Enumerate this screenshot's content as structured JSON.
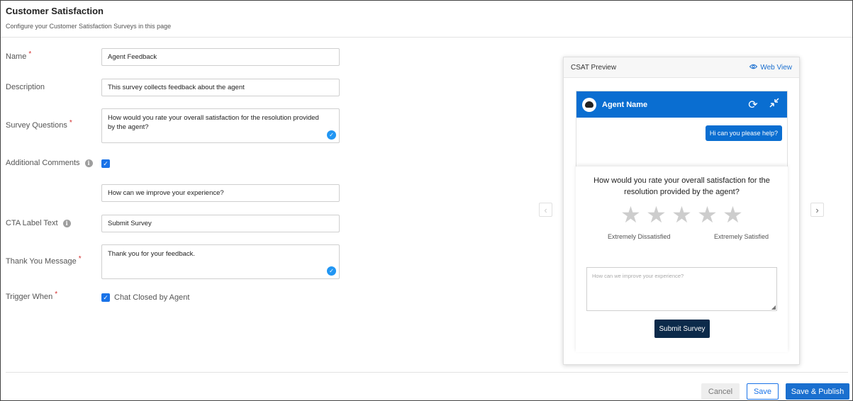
{
  "page": {
    "title": "Customer Satisfaction",
    "subtitle": "Configure your Customer Satisfaction Surveys in this page"
  },
  "form": {
    "name": {
      "label": "Name",
      "value": "Agent Feedback"
    },
    "description": {
      "label": "Description",
      "value": "This survey collects feedback about the agent"
    },
    "survey_questions": {
      "label": "Survey Questions",
      "value": "How would you rate your overall satisfaction for the resolution provided by the agent?"
    },
    "additional_comments": {
      "label": "Additional Comments",
      "checked": true,
      "value": "How can we improve your experience?"
    },
    "cta_label": {
      "label": "CTA Label Text",
      "value": "Submit Survey"
    },
    "thank_you": {
      "label": "Thank You Message",
      "value": "Thank you for your feedback."
    },
    "trigger_when": {
      "label": "Trigger When",
      "option_label": "Chat Closed by Agent",
      "checked": true
    },
    "required_mark": "*",
    "info_glyph": "i",
    "check_glyph": "✓"
  },
  "preview": {
    "title": "CSAT Preview",
    "web_view": "Web View",
    "agent_name": "Agent Name",
    "user_message": "Hi can you please help?",
    "question": "How would you rate your overall satisfaction for the resolution provided by the agent?",
    "rating": {
      "value": 0,
      "max": 5
    },
    "scale_low": "Extremely Dissatisfied",
    "scale_high": "Extremely Satisfied",
    "comment_placeholder": "How can we improve your experience?",
    "submit_label": "Submit Survey"
  },
  "icons": {
    "eye": "eye-icon",
    "refresh": "refresh-icon",
    "minimize": "minimize-icon",
    "prev": "chevron-left-icon",
    "next": "chevron-right-icon"
  },
  "footer": {
    "cancel": "Cancel",
    "save": "Save",
    "save_publish": "Save & Publish"
  },
  "colors": {
    "primary": "#1a6fcf",
    "chat_header": "#0a6ed1",
    "submit_button": "#0c2a4a",
    "required": "#d32f2f"
  }
}
